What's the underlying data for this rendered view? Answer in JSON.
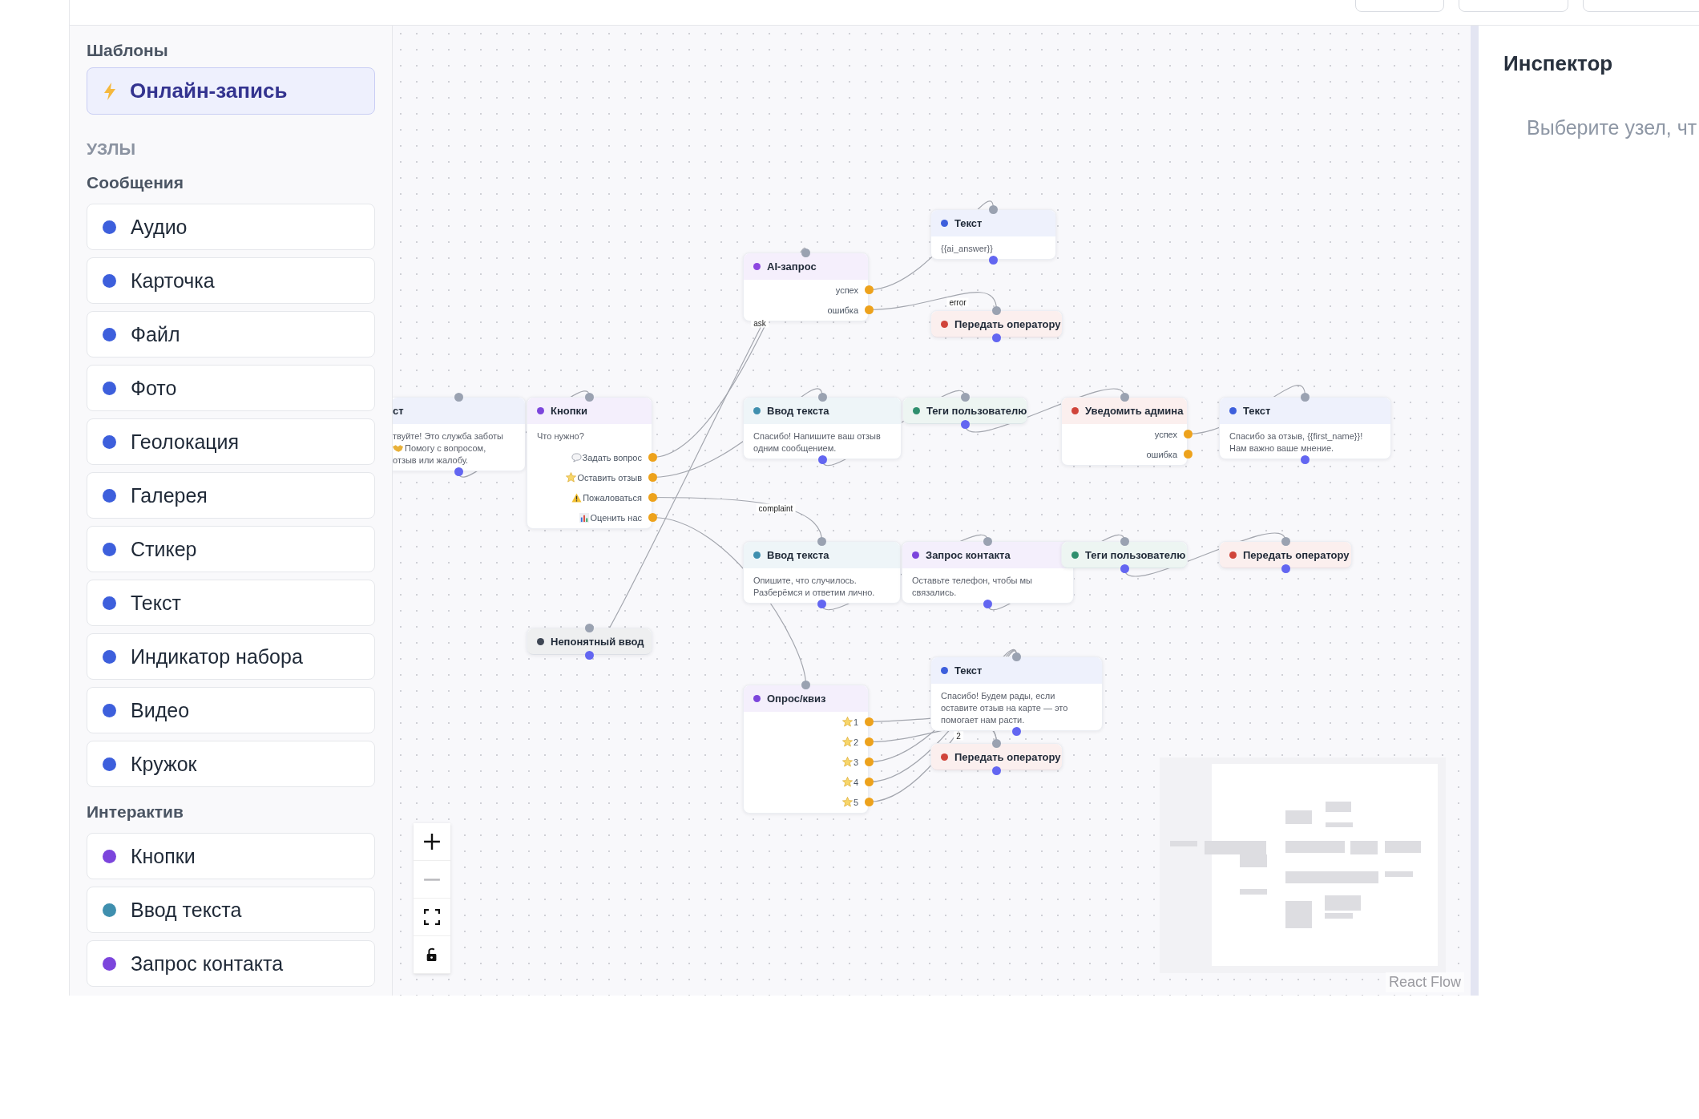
{
  "sidebar": {
    "templates_title": "Шаблоны",
    "templates": [
      {
        "label": "Онлайн-запись"
      }
    ],
    "nodes_title": "УЗЛЫ",
    "groups": [
      {
        "title": "Сообщения",
        "items": [
          {
            "label": "Аудио",
            "color": "#3d5fdc"
          },
          {
            "label": "Карточка",
            "color": "#3d5fdc"
          },
          {
            "label": "Файл",
            "color": "#3d5fdc"
          },
          {
            "label": "Фото",
            "color": "#3d5fdc"
          },
          {
            "label": "Геолокация",
            "color": "#3d5fdc"
          },
          {
            "label": "Галерея",
            "color": "#3d5fdc"
          },
          {
            "label": "Стикер",
            "color": "#3d5fdc"
          },
          {
            "label": "Текст",
            "color": "#3d5fdc"
          },
          {
            "label": "Индикатор набора",
            "color": "#3d5fdc"
          },
          {
            "label": "Видео",
            "color": "#3d5fdc"
          },
          {
            "label": "Кружок",
            "color": "#3d5fdc"
          }
        ]
      },
      {
        "title": "Интерактив",
        "items": [
          {
            "label": "Кнопки",
            "color": "#7c45dc"
          },
          {
            "label": "Ввод текста",
            "color": "#3f8fae"
          },
          {
            "label": "Запрос контакта",
            "color": "#7c45dc"
          }
        ]
      }
    ]
  },
  "canvas": {
    "nodes": [
      {
        "title": "ст",
        "lines": [
          {
            "text": "твуйте! Это служба заботы"
          },
          {
            "text": "Помогу с вопросом,",
            "kind": "handshake"
          },
          {
            "text": "отзыв или жалобу."
          }
        ]
      },
      {
        "title": "Кнопки",
        "color": "#7c45dc",
        "lines": [
          {
            "text": "Что нужно?"
          }
        ],
        "outputs": [
          {
            "label": "Задать вопрос",
            "kind": "speech"
          },
          {
            "label": "Оставить отзыв",
            "kind": "star"
          },
          {
            "label": "Пожаловаться",
            "kind": "warning"
          },
          {
            "label": "Оценить нас",
            "kind": "chart"
          }
        ]
      },
      {
        "title": "AI-запрос",
        "color": "#8d46e0",
        "outputs": [
          {
            "label": "успех"
          },
          {
            "label": "ошибка"
          }
        ]
      },
      {
        "title": "Текст",
        "color": "#3d5fdc",
        "lines": [
          {
            "text": "{{ai_answer}}"
          }
        ]
      },
      {
        "title": "Передать оператору",
        "color": "#d0443a"
      },
      {
        "title": "Ввод текста",
        "color": "#3f8fae",
        "lines": [
          {
            "text": "Спасибо! Напишите ваш отзыв"
          },
          {
            "text": "одним сообщением."
          }
        ]
      },
      {
        "title": "Теги пользователю",
        "color": "#2f8f6e"
      },
      {
        "title": "Уведомить админа",
        "color": "#d0443a",
        "outputs": [
          {
            "label": "успех"
          },
          {
            "label": "ошибка"
          }
        ]
      },
      {
        "title": "Текст",
        "color": "#3d5fdc",
        "lines": [
          {
            "text": "Спасибо за отзыв, {{first_name}}!"
          },
          {
            "text": "Нам важно ваше мнение."
          }
        ]
      },
      {
        "title": "Ввод текста",
        "color": "#3f8fae",
        "lines": [
          {
            "text": "Опишите, что случилось."
          },
          {
            "text": "Разберёмся и ответим лично."
          }
        ]
      },
      {
        "title": "Запрос контакта",
        "color": "#7c45dc",
        "lines": [
          {
            "text": "Оставьте телефон, чтобы мы"
          },
          {
            "text": "связались."
          }
        ]
      },
      {
        "title": "Теги пользователю",
        "color": "#2f8f6e"
      },
      {
        "title": "Передать оператору",
        "color": "#d0443a"
      },
      {
        "title": "Непонятный ввод",
        "color": "#3e4654"
      },
      {
        "title": "Опрос/квиз",
        "color": "#7c45dc",
        "outputs": [
          {
            "label": "1",
            "kind": "star"
          },
          {
            "label": "2",
            "kind": "star"
          },
          {
            "label": "3",
            "kind": "star"
          },
          {
            "label": "4",
            "kind": "star"
          },
          {
            "label": "5",
            "kind": "star"
          }
        ]
      },
      {
        "title": "Текст",
        "color": "#3d5fdc",
        "lines": [
          {
            "text": "Спасибо! Будем рады, если"
          },
          {
            "text": "оставите отзыв на карте — это"
          },
          {
            "text": "помогает нам расти."
          }
        ]
      },
      {
        "title": "Передать оператору",
        "color": "#d0443a"
      }
    ],
    "edge_labels": [
      {
        "text": "ask"
      },
      {
        "text": "error"
      },
      {
        "text": "complaint"
      },
      {
        "text": "2"
      }
    ],
    "controls": [
      {
        "kind": "zoom-in",
        "disabled": false
      },
      {
        "kind": "zoom-out",
        "disabled": true
      },
      {
        "kind": "fit",
        "disabled": false
      },
      {
        "kind": "lock",
        "disabled": false
      }
    ],
    "attribution": "React Flow"
  },
  "inspector": {
    "title": "Инспектор",
    "hint": "Выберите узел, чт"
  }
}
